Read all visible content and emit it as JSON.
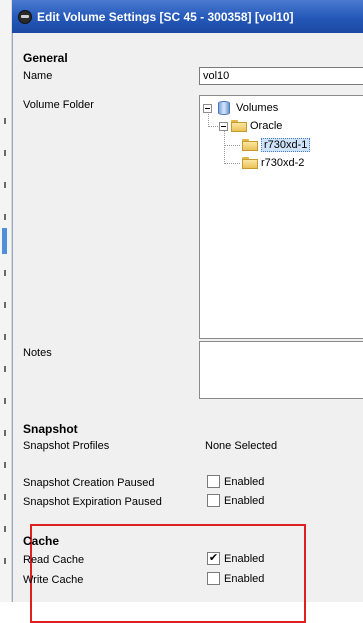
{
  "window": {
    "title": "Edit Volume Settings [SC 45 - 300358] [vol10]"
  },
  "general": {
    "heading": "General",
    "name_label": "Name",
    "name_value": "vol10",
    "folder_label": "Volume Folder",
    "tree": {
      "root": "Volumes",
      "child": "Oracle",
      "items": [
        "r730xd-1",
        "r730xd-2"
      ],
      "selected": "r730xd-1"
    },
    "notes_label": "Notes",
    "notes_value": ""
  },
  "snapshot": {
    "heading": "Snapshot",
    "profiles_label": "Snapshot Profiles",
    "profiles_value": "None Selected",
    "creation_paused_label": "Snapshot Creation Paused",
    "creation_paused_checked": false,
    "expiration_paused_label": "Snapshot Expiration Paused",
    "expiration_paused_checked": false,
    "enabled_label": "Enabled"
  },
  "cache": {
    "heading": "Cache",
    "read_label": "Read Cache",
    "read_checked": true,
    "write_label": "Write Cache",
    "write_checked": false,
    "enabled_label": "Enabled"
  },
  "colors": {
    "titlebar": "#2458b8",
    "highlight_border": "#e02020",
    "dialog_bg": "#f0f0f0",
    "selection_bg": "#cfe3fa"
  },
  "icons": {
    "app": "app-icon",
    "database": "database-icon",
    "folder": "folder-icon",
    "checkbox_checked": "checkmark-icon"
  }
}
